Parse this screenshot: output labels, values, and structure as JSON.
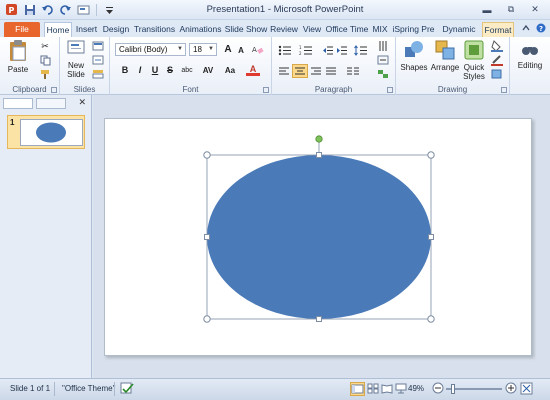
{
  "window": {
    "title": "Presentation1 - Microsoft PowerPoint"
  },
  "colors": {
    "shape_fill": "#4a7ab8",
    "file_tab": "#e8662c",
    "rotate_handle": "#7dc35a"
  },
  "quick_access": [
    {
      "icon": "powerpoint-logo-icon"
    },
    {
      "icon": "save-icon"
    },
    {
      "icon": "undo-icon"
    },
    {
      "icon": "redo-icon"
    },
    {
      "icon": "slide-layout-icon"
    },
    {
      "icon": "customize-toolbar-icon"
    }
  ],
  "window_controls": [
    {
      "icon": "minimize-icon",
      "glyph": "▬"
    },
    {
      "icon": "restore-icon",
      "glyph": "⧉"
    },
    {
      "icon": "close-icon",
      "glyph": "✕"
    }
  ],
  "tabs": [
    {
      "label": "File"
    },
    {
      "label": "Home"
    },
    {
      "label": "Insert"
    },
    {
      "label": "Design"
    },
    {
      "label": "Transitions"
    },
    {
      "label": "Animations"
    },
    {
      "label": "Slide Show"
    },
    {
      "label": "Review"
    },
    {
      "label": "View"
    },
    {
      "label": "Office Time"
    },
    {
      "label": "MIX"
    },
    {
      "label": "iSpring Pre"
    },
    {
      "label": "Dynamic EL"
    },
    {
      "label": "Format"
    }
  ],
  "ribbon": {
    "clipboard": {
      "label": "Clipboard",
      "paste": "Paste"
    },
    "slides": {
      "label": "Slides",
      "new_slide_1": "New",
      "new_slide_2": "Slide"
    },
    "font": {
      "label": "Font",
      "font_name": "Calibri (Body)",
      "font_size": "18",
      "bold": "B",
      "italic": "I",
      "underline": "U",
      "strike": "S",
      "shadow": "abc",
      "spacing": "AV",
      "case": "Aa",
      "color": "A",
      "grow": "A",
      "shrink": "A"
    },
    "paragraph": {
      "label": "Paragraph"
    },
    "drawing": {
      "label": "Drawing",
      "shapes": "Shapes",
      "arrange": "Arrange",
      "quick_styles_1": "Quick",
      "quick_styles_2": "Styles"
    },
    "editing": {
      "label": "Editing"
    }
  },
  "slides_pane": {
    "slide_number": "1"
  },
  "status": {
    "slide_info": "Slide 1 of 1",
    "theme": "\"Office Theme\"",
    "zoom": "49%"
  }
}
